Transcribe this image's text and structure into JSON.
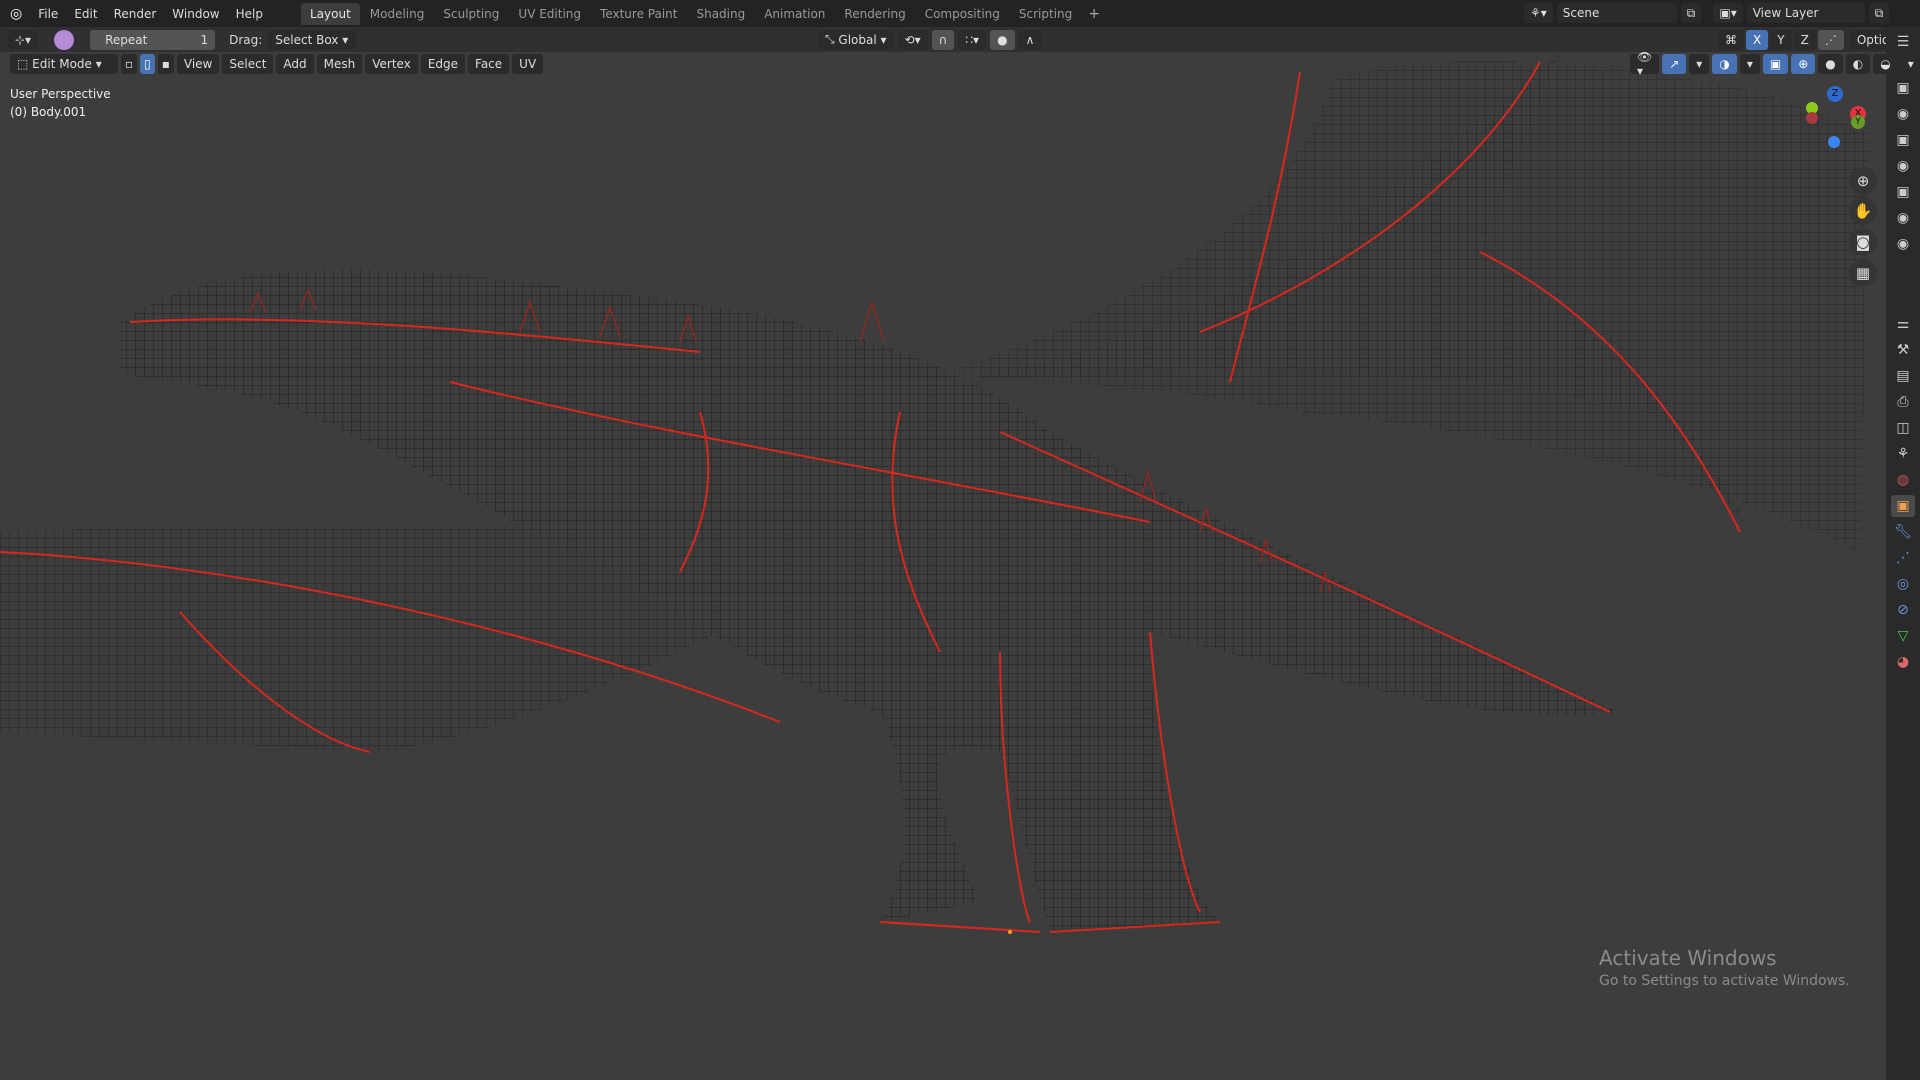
{
  "menu": [
    "File",
    "Edit",
    "Render",
    "Window",
    "Help"
  ],
  "workspaces": [
    "Layout",
    "Modeling",
    "Sculpting",
    "UV Editing",
    "Texture Paint",
    "Shading",
    "Animation",
    "Rendering",
    "Compositing",
    "Scripting"
  ],
  "active_workspace": "Layout",
  "add_tab": "+",
  "scene": "Scene",
  "view_layer": "View Layer",
  "tool_header": {
    "repeat_label": "Repeat",
    "repeat_count": "1",
    "drag_label": "Drag:",
    "drag_value": "Select Box",
    "orientation": "Global",
    "axes": [
      "X",
      "Y",
      "Z"
    ],
    "options": "Options"
  },
  "view_header": {
    "mode": "Edit Mode",
    "menus": [
      "View",
      "Select",
      "Add",
      "Mesh",
      "Vertex",
      "Edge",
      "Face",
      "UV"
    ]
  },
  "overlay": {
    "perspective": "User Perspective",
    "object": "(0) Body.001"
  },
  "gizmo": {
    "z": "Z",
    "x": "X",
    "y": "Y"
  },
  "watermark": {
    "title": "Activate Windows",
    "subtitle": "Go to Settings to activate Windows."
  },
  "colors": {
    "accent": "#4772b3",
    "seam": "#d8271f",
    "wire": "#1e1e1e"
  }
}
